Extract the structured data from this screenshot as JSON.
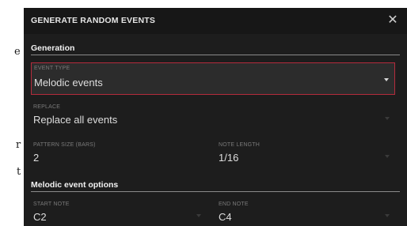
{
  "background_letters": [
    "e",
    "r",
    "t"
  ],
  "dialog": {
    "title": "GENERATE RANDOM EVENTS",
    "close_icon": "close-icon",
    "sections": {
      "generation": "Generation",
      "melodic": "Melodic event options"
    },
    "fields": {
      "event_type": {
        "label": "EVENT TYPE",
        "value": "Melodic events"
      },
      "replace": {
        "label": "REPLACE",
        "value": "Replace all events"
      },
      "pattern_size": {
        "label": "PATTERN SIZE (BARS)",
        "value": "2"
      },
      "note_length": {
        "label": "NOTE LENGTH",
        "value": "1/16"
      },
      "start_note": {
        "label": "START NOTE",
        "value": "C2"
      },
      "end_note": {
        "label": "END NOTE",
        "value": "C4"
      }
    }
  },
  "colors": {
    "dialog_bg": "#1d1d1d",
    "active_border": "#b52b3c",
    "text": "#dedede"
  }
}
